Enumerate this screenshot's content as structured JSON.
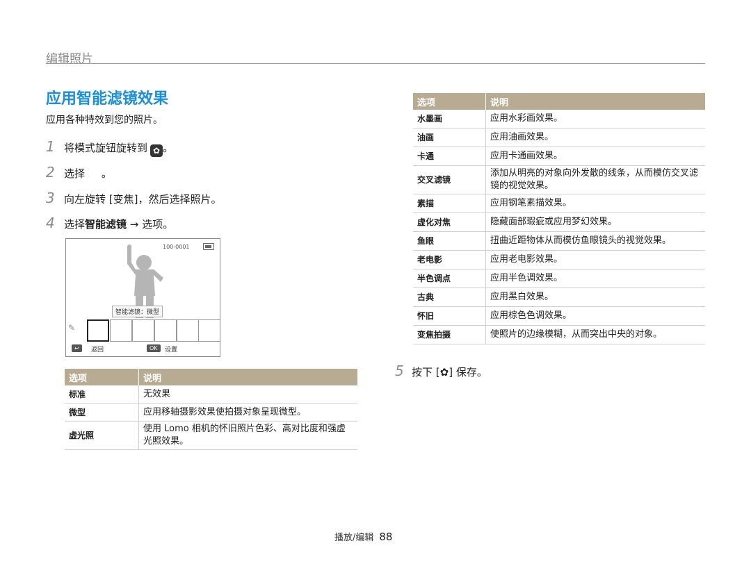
{
  "header": {
    "section_title": "编辑照片"
  },
  "page": {
    "title": "应用智能滤镜效果",
    "intro": "应用各种特效到您的照片。"
  },
  "steps": [
    {
      "num": "1",
      "pre": "将模式旋钮旋转到",
      "icon": "✿",
      "post": "。"
    },
    {
      "num": "2",
      "text": "选择     。"
    },
    {
      "num": "3",
      "text": "向左旋转 [变焦]，然后选择照片。"
    },
    {
      "num": "4",
      "pre": "选择",
      "bold": "智能滤镜",
      "post": " → 选项。"
    }
  ],
  "screen": {
    "counter": "100-0001",
    "filter_label": "智能滤镜：微型",
    "back_key": "↩",
    "back_label": "返回",
    "ok_key": "OK",
    "ok_label": "设置"
  },
  "table_left": {
    "headers": [
      "选项",
      "说明"
    ],
    "rows": [
      {
        "option": "标准",
        "desc": "无效果"
      },
      {
        "option": "微型",
        "desc": "应用移轴摄影效果使拍摄对象呈现微型。"
      },
      {
        "option": "虚光照",
        "desc": "使用 Lomo 相机的怀旧照片色彩、高对比度和强虚光照效果。"
      }
    ]
  },
  "table_right": {
    "headers": [
      "选项",
      "说明"
    ],
    "rows": [
      {
        "option": "水墨画",
        "desc": "应用水彩画效果。"
      },
      {
        "option": "油画",
        "desc": "应用油画效果。"
      },
      {
        "option": "卡通",
        "desc": "应用卡通画效果。"
      },
      {
        "option": "交叉滤镜",
        "desc": "添加从明亮的对象向外发散的线条，从而模仿交叉滤镜的视觉效果。"
      },
      {
        "option": "素描",
        "desc": "应用钢笔素描效果。"
      },
      {
        "option": "虚化对焦",
        "desc": "隐藏面部瑕疵或应用梦幻效果。"
      },
      {
        "option": "鱼眼",
        "desc": "扭曲近距物体从而模仿鱼眼镜头的视觉效果。"
      },
      {
        "option": "老电影",
        "desc": "应用老电影效果。"
      },
      {
        "option": "半色调点",
        "desc": "应用半色调效果。"
      },
      {
        "option": "古典",
        "desc": "应用黑白效果。"
      },
      {
        "option": "怀旧",
        "desc": "应用棕色色调效果。"
      },
      {
        "option": "变焦拍摄",
        "desc": "使照片的边缘模糊，从而突出中央的对象。"
      }
    ]
  },
  "step5": {
    "num": "5",
    "pre": "按下 [",
    "icon": "✿",
    "post": "] 保存。"
  },
  "footer": {
    "section": "播放/编辑",
    "page_number": "88"
  },
  "colors": {
    "title_blue": "#1a8fd8",
    "table_header": "#b7ab92"
  }
}
